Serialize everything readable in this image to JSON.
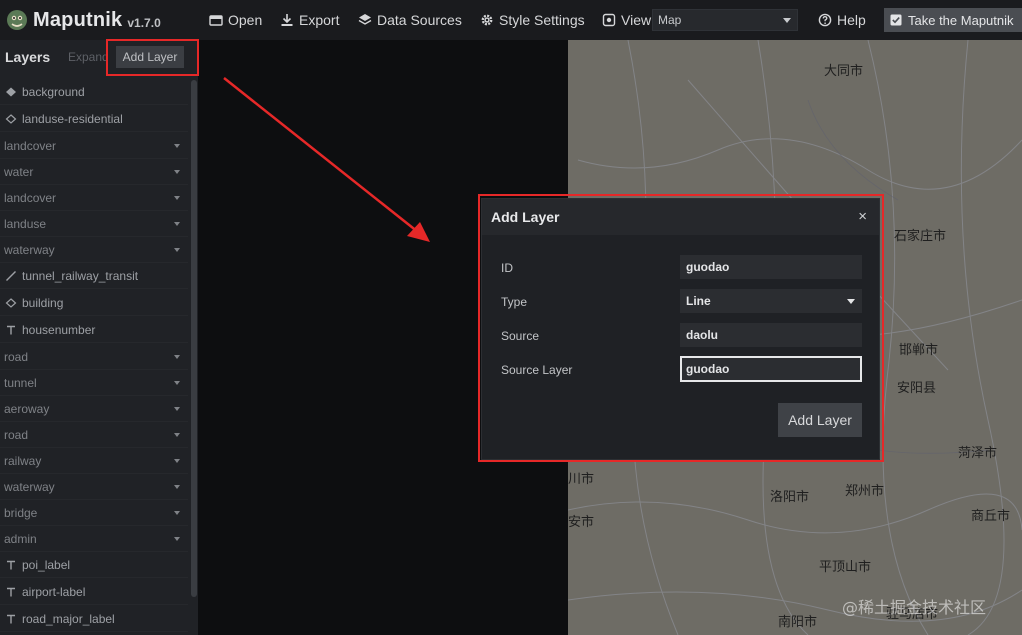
{
  "app": {
    "name": "Maputnik",
    "version": "v1.7.0"
  },
  "toolbar": {
    "open": "Open",
    "export": "Export",
    "data_sources": "Data Sources",
    "style_settings": "Style Settings",
    "view": "View",
    "view_value": "Map",
    "help": "Help",
    "tour": "Take the Maputnik"
  },
  "sidebar": {
    "title": "Layers",
    "expand": "Expand",
    "add_layer": "Add Layer",
    "layers": [
      {
        "label": "background",
        "kind": "fill-icon"
      },
      {
        "label": "landuse-residential",
        "kind": "outline-icon"
      },
      {
        "label": "landcover",
        "kind": "group"
      },
      {
        "label": "water",
        "kind": "group"
      },
      {
        "label": "landcover",
        "kind": "group"
      },
      {
        "label": "landuse",
        "kind": "group"
      },
      {
        "label": "waterway",
        "kind": "group"
      },
      {
        "label": "tunnel_railway_transit",
        "kind": "line-icon"
      },
      {
        "label": "building",
        "kind": "outline-icon"
      },
      {
        "label": "housenumber",
        "kind": "text-icon"
      },
      {
        "label": "road",
        "kind": "group"
      },
      {
        "label": "tunnel",
        "kind": "group"
      },
      {
        "label": "aeroway",
        "kind": "group"
      },
      {
        "label": "road",
        "kind": "group"
      },
      {
        "label": "railway",
        "kind": "group"
      },
      {
        "label": "waterway",
        "kind": "group"
      },
      {
        "label": "bridge",
        "kind": "group"
      },
      {
        "label": "admin",
        "kind": "group"
      },
      {
        "label": "poi_label",
        "kind": "text-icon"
      },
      {
        "label": "airport-label",
        "kind": "text-icon"
      },
      {
        "label": "road_major_label",
        "kind": "text-icon"
      }
    ]
  },
  "modal": {
    "title": "Add Layer",
    "close": "×",
    "fields": [
      {
        "label": "ID",
        "value": "guodao"
      },
      {
        "label": "Type",
        "value": "Line"
      },
      {
        "label": "Source",
        "value": "daolu"
      },
      {
        "label": "Source Layer",
        "value": "guodao"
      }
    ],
    "submit": "Add Layer"
  },
  "map": {
    "labels": [
      "大同市",
      "石家庄市",
      "邯郸市",
      "安阳县",
      "菏泽市",
      "川市",
      "洛阳市",
      "郑州市",
      "安市",
      "商丘市",
      "平顶山市",
      "南阳市",
      "驻马店市"
    ]
  },
  "watermark": "@稀土掘金技术社区",
  "colors": {
    "highlight": "#e62828",
    "map_bg": "#6e6c65",
    "panel_bg": "#202226"
  }
}
